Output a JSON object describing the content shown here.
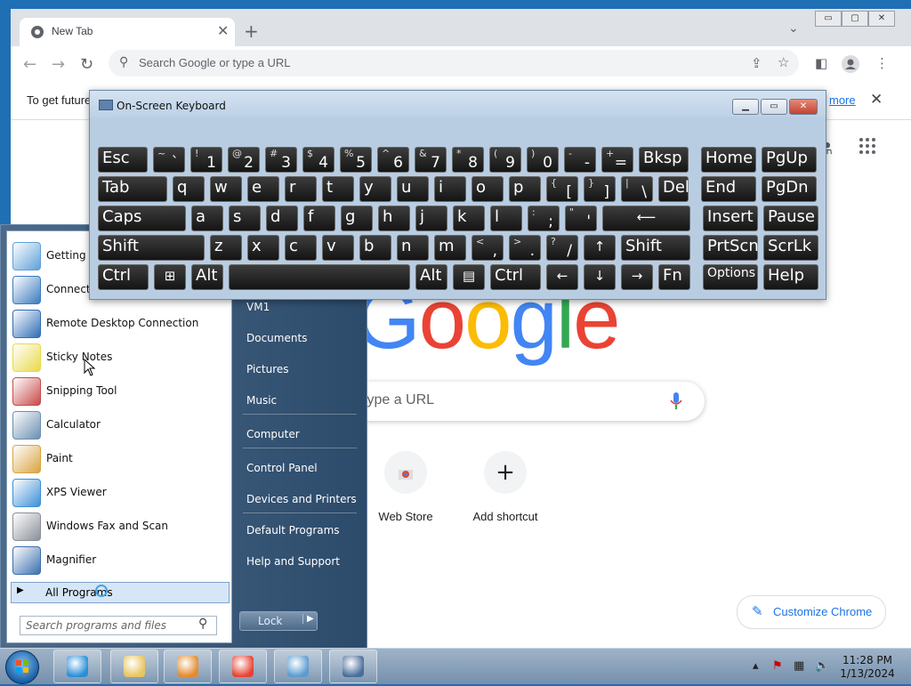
{
  "chrome": {
    "tab_title": "New Tab",
    "tab_close": "✕",
    "new_tab": "+",
    "tab_menu": "⌄",
    "window_buttons": [
      "▭",
      "▢",
      "✕"
    ],
    "omnibox_placeholder": "Search Google or type a URL",
    "infobar_text": "To get future",
    "infobar_link": "more",
    "infobar_close": "✕",
    "logo_letters": [
      {
        "ch": "G",
        "color": "#4285f4"
      },
      {
        "ch": "o",
        "color": "#ea4335"
      },
      {
        "ch": "o",
        "color": "#fbbc05"
      },
      {
        "ch": "g",
        "color": "#4285f4"
      },
      {
        "ch": "l",
        "color": "#34a853"
      },
      {
        "ch": "e",
        "color": "#ea4335"
      }
    ],
    "ntp_search_placeholder": "type a URL",
    "shortcuts": [
      {
        "label": "Web Store",
        "icon": "web-store-icon"
      },
      {
        "label": "Add shortcut",
        "icon": "plus-icon",
        "glyph": "+"
      }
    ],
    "customize_label": "Customize Chrome"
  },
  "osk": {
    "title": "On-Screen Keyboard",
    "rows": [
      [
        {
          "m": "Esc",
          "w": 58
        },
        {
          "s": "~",
          "b": "`",
          "w": 38
        },
        {
          "s": "!",
          "b": "1",
          "w": 38
        },
        {
          "s": "@",
          "b": "2",
          "w": 38
        },
        {
          "s": "#",
          "b": "3",
          "w": 38
        },
        {
          "s": "$",
          "b": "4",
          "w": 38
        },
        {
          "s": "%",
          "b": "5",
          "w": 38
        },
        {
          "s": "^",
          "b": "6",
          "w": 38
        },
        {
          "s": "&",
          "b": "7",
          "w": 38
        },
        {
          "s": "*",
          "b": "8",
          "w": 38
        },
        {
          "s": "(",
          "b": "9",
          "w": 38
        },
        {
          "s": ")",
          "b": "0",
          "w": 38
        },
        {
          "s": "-",
          "b": "-",
          "w": 38
        },
        {
          "s": "+",
          "b": "=",
          "w": 38
        },
        {
          "m": "Bksp",
          "w": 58
        },
        {
          "m": "Home",
          "w": 64,
          "gap": 8
        },
        {
          "m": "PgUp",
          "w": 64
        }
      ],
      [
        {
          "m": "Tab",
          "w": 80
        },
        {
          "m": "q",
          "w": 38
        },
        {
          "m": "w",
          "w": 38
        },
        {
          "m": "e",
          "w": 38
        },
        {
          "m": "r",
          "w": 38
        },
        {
          "m": "t",
          "w": 38
        },
        {
          "m": "y",
          "w": 38
        },
        {
          "m": "u",
          "w": 38
        },
        {
          "m": "i",
          "w": 38
        },
        {
          "m": "o",
          "w": 38
        },
        {
          "m": "p",
          "w": 38
        },
        {
          "s": "{",
          "b": "[",
          "w": 38
        },
        {
          "s": "}",
          "b": "]",
          "w": 38
        },
        {
          "s": "|",
          "b": "\\",
          "w": 38
        },
        {
          "m": "Del",
          "w": 36
        },
        {
          "m": "End",
          "w": 64,
          "gap": 8
        },
        {
          "m": "PgDn",
          "w": 64
        }
      ],
      [
        {
          "m": "Caps",
          "w": 101
        },
        {
          "m": "a",
          "w": 38
        },
        {
          "m": "s",
          "w": 38
        },
        {
          "m": "d",
          "w": 38
        },
        {
          "m": "f",
          "w": 38
        },
        {
          "m": "g",
          "w": 38
        },
        {
          "m": "h",
          "w": 38
        },
        {
          "m": "j",
          "w": 38
        },
        {
          "m": "k",
          "w": 38
        },
        {
          "m": "l",
          "w": 38
        },
        {
          "s": ":",
          "b": ";",
          "w": 38
        },
        {
          "s": "\"",
          "b": "'",
          "w": 38
        },
        {
          "i": "⟵",
          "w": 101
        },
        {
          "m": "Insert",
          "w": 64,
          "gap": 8
        },
        {
          "m": "Pause",
          "w": 64
        }
      ],
      [
        {
          "m": "Shift",
          "w": 122
        },
        {
          "m": "z",
          "w": 38
        },
        {
          "m": "x",
          "w": 38
        },
        {
          "m": "c",
          "w": 38
        },
        {
          "m": "v",
          "w": 38
        },
        {
          "m": "b",
          "w": 38
        },
        {
          "m": "n",
          "w": 38
        },
        {
          "m": "m",
          "w": 38
        },
        {
          "s": "<",
          "b": ",",
          "w": 38
        },
        {
          "s": ">",
          "b": ".",
          "w": 38
        },
        {
          "s": "?",
          "b": "/",
          "w": 38
        },
        {
          "i": "↑",
          "w": 38
        },
        {
          "m": "Shift",
          "w": 80
        },
        {
          "m": "PrtScn",
          "w": 64,
          "gap": 8
        },
        {
          "m": "ScrLk",
          "w": 64
        }
      ],
      [
        {
          "m": "Ctrl",
          "w": 59
        },
        {
          "i": "⊞",
          "w": 38
        },
        {
          "m": "Alt",
          "w": 38
        },
        {
          "m": "",
          "w": 206
        },
        {
          "m": "Alt",
          "w": 38
        },
        {
          "i": "▤",
          "w": 38
        },
        {
          "m": "Ctrl",
          "w": 59
        },
        {
          "i": "←",
          "w": 38
        },
        {
          "i": "↓",
          "w": 38
        },
        {
          "i": "→",
          "w": 38
        },
        {
          "m": "Fn",
          "w": 38
        },
        {
          "m": "Options",
          "w": 64,
          "gap": 8,
          "small": true
        },
        {
          "m": "Help",
          "w": 64
        }
      ]
    ]
  },
  "startmenu": {
    "left_items": [
      {
        "label": "Getting S",
        "icon": "getting-started-icon",
        "color": "#5fa0d8"
      },
      {
        "label": "Connect t",
        "icon": "connect-projector-icon",
        "color": "#3a7bc0"
      },
      {
        "label": "Remote Desktop Connection",
        "icon": "remote-desktop-icon",
        "color": "#2f6db5"
      },
      {
        "label": "Sticky Notes",
        "icon": "sticky-notes-icon",
        "color": "#e9d94a"
      },
      {
        "label": "Snipping Tool",
        "icon": "snipping-tool-icon",
        "color": "#c84a4a"
      },
      {
        "label": "Calculator",
        "icon": "calculator-icon",
        "color": "#6b8fb0"
      },
      {
        "label": "Paint",
        "icon": "paint-icon",
        "color": "#d9a441"
      },
      {
        "label": "XPS Viewer",
        "icon": "xps-viewer-icon",
        "color": "#3c8fd6"
      },
      {
        "label": "Windows Fax and Scan",
        "icon": "fax-scan-icon",
        "color": "#8a8f99"
      },
      {
        "label": "Magnifier",
        "icon": "magnifier-icon",
        "color": "#3b6fae"
      }
    ],
    "all_programs": "All Programs",
    "search_placeholder": "Search programs and files",
    "right_items": [
      "VM1",
      "Documents",
      "Pictures",
      "Music",
      "Computer",
      "Control Panel",
      "Devices and Printers",
      "Default Programs",
      "Help and Support"
    ],
    "lock_label": "Lock",
    "lock_arrow": "▶"
  },
  "taskbar": {
    "apps": [
      {
        "name": "internet-explorer",
        "color": "#2a8fd8"
      },
      {
        "name": "windows-explorer",
        "color": "#e8c561"
      },
      {
        "name": "media-player",
        "color": "#e38b2f"
      },
      {
        "name": "chrome",
        "color": "#e84335"
      },
      {
        "name": "media-center",
        "color": "#5c9bd1"
      },
      {
        "name": "on-screen-keyboard",
        "color": "#4a6e99"
      }
    ],
    "time": "11:28 PM",
    "date": "1/13/2024"
  }
}
